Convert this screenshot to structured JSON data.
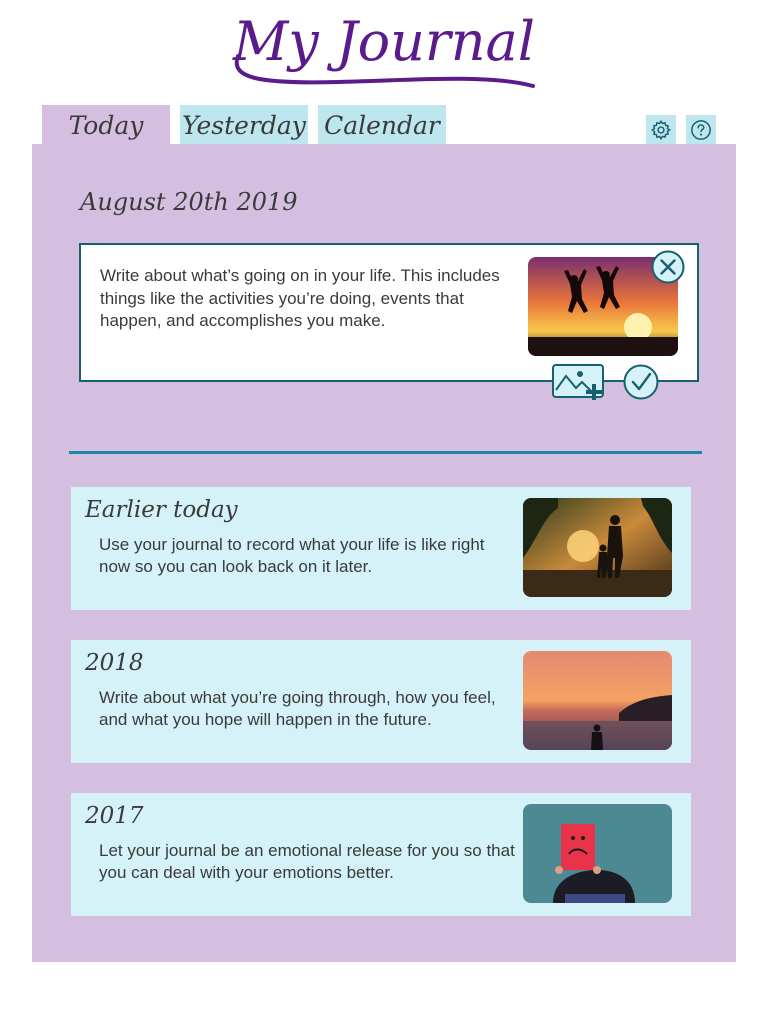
{
  "app": {
    "title": "My Journal"
  },
  "tabs": [
    {
      "label": "Today",
      "active": true
    },
    {
      "label": "Yesterday",
      "active": false
    },
    {
      "label": "Calendar",
      "active": false
    }
  ],
  "toolbar": {
    "settings_icon": "gear-icon",
    "help_icon": "help-icon"
  },
  "new_entry": {
    "date": "August 20th 2019",
    "text": "Write about what’s going on in your life. This includes things like the activities you’re doing, events that happen, and accomplishes you make.",
    "photo": "jumping-silhouettes-sunset",
    "close_icon": "close-icon",
    "add_image_icon": "add-image-icon",
    "confirm_icon": "checkmark-icon"
  },
  "entries": [
    {
      "title": "Earlier today",
      "text": "Use your journal to record what your life is like right now so you can look back on it later.",
      "photo": "parent-child-sunset-walk"
    },
    {
      "title": "2018",
      "text": "Write about what you’re going through, how you feel, and what you hope will happen in the future.",
      "photo": "person-at-beach-sunset"
    },
    {
      "title": "2017",
      "text": "Let your journal be an emotional release for you so that you can deal with your emotions better.",
      "photo": "person-with-sad-face-sign"
    }
  ],
  "colors": {
    "title": "#5a1c8c",
    "panel": "#d5bfe1",
    "tab_inactive": "#bde6ef",
    "card": "#d5f2f8",
    "accent": "#17606e",
    "divider": "#1f86a8"
  }
}
